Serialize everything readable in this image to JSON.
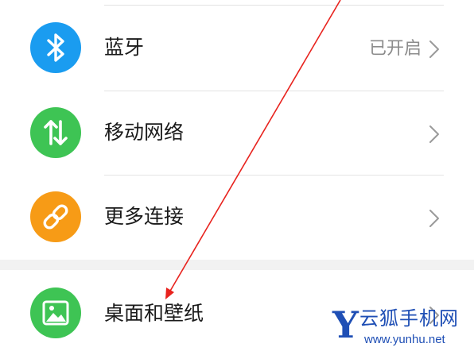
{
  "settings": {
    "items": [
      {
        "label": "蓝牙",
        "status": "已开启",
        "icon": "bluetooth-icon",
        "color": "#1a9cf0",
        "has_chevron": true
      },
      {
        "label": "移动网络",
        "status": "",
        "icon": "data-transfer-icon",
        "color": "#3ec454",
        "has_chevron": true
      },
      {
        "label": "更多连接",
        "status": "",
        "icon": "link-icon",
        "color": "#f79b16",
        "has_chevron": true
      },
      {
        "label": "桌面和壁纸",
        "status": "",
        "icon": "image-icon",
        "color": "#3ec454",
        "has_chevron": true
      }
    ]
  },
  "annotation": {
    "arrow_color": "#e8231e"
  },
  "watermark": {
    "letter": "Y",
    "title": "云狐手机网",
    "url": "www.yunhu.net",
    "color": "#1f4fb5"
  }
}
